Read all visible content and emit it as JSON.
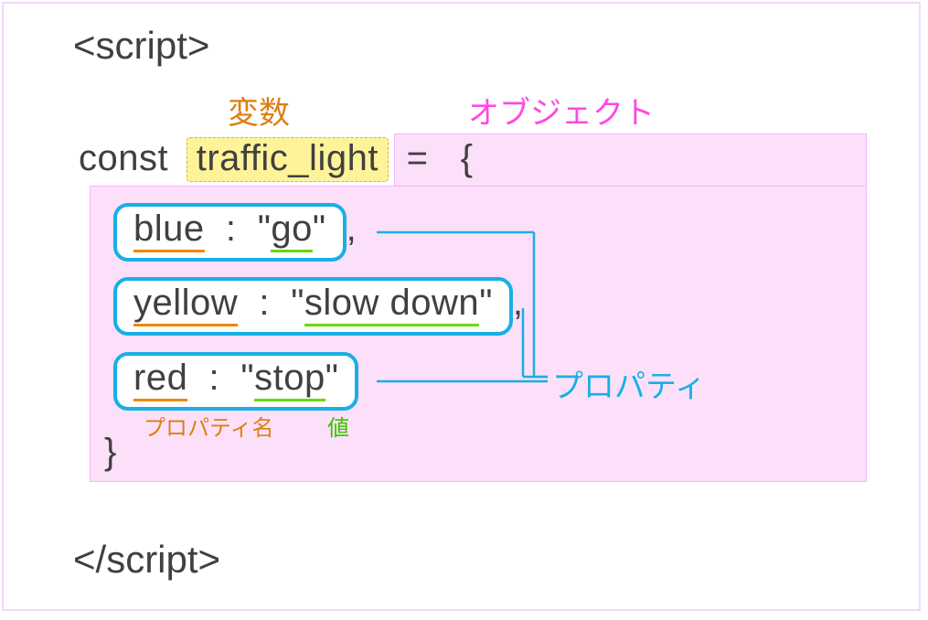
{
  "labels": {
    "variable": "変数",
    "object": "オブジェクト",
    "property": "プロパティ",
    "property_name": "プロパティ名",
    "value": "値"
  },
  "code": {
    "open_tag": "<script>",
    "close_tag": "</script>",
    "const_kw": "const",
    "var_name": "traffic_light",
    "equals": " = ",
    "brace_open": "{",
    "brace_close": "}",
    "props": [
      {
        "name": "blue",
        "value": "go",
        "comma": ","
      },
      {
        "name": "yellow",
        "value": "slow down",
        "comma": ","
      },
      {
        "name": "red",
        "value": "stop",
        "comma": ""
      }
    ]
  },
  "colors": {
    "variable_label": "#dd7e13",
    "object_label": "#ff49e1",
    "property_label": "#19afe6",
    "value_label": "#38c300",
    "variable_highlight_bg": "#fff39a",
    "variable_highlight_border": "#e8a838",
    "object_bg": "#fce0fa",
    "object_border": "#f4b6f7",
    "property_border": "#19afe6",
    "underline_name": "#f18700",
    "underline_value": "#66d900",
    "code_text": "#404040",
    "canvas_border": "#f1d9fa"
  }
}
